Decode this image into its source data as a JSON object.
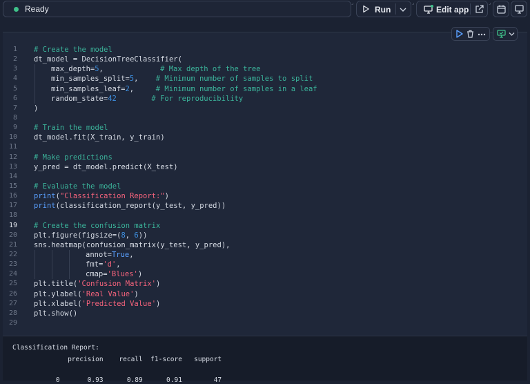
{
  "toolbar": {
    "status": "Ready",
    "run_label": "Run",
    "edit_app_label": "Edit app",
    "colors": {
      "status_dot": "#3fc28a",
      "accent": "#3e8fe0"
    }
  },
  "code": {
    "active_line": 19,
    "lines": [
      {
        "n": "1",
        "segs": [
          {
            "t": "# Create the model",
            "k": "comment"
          }
        ]
      },
      {
        "n": "2",
        "segs": [
          {
            "t": "dt_model = DecisionTreeClassifier(",
            "k": "plain"
          }
        ]
      },
      {
        "n": "3",
        "indent": 1,
        "segs": [
          {
            "t": "max_depth=",
            "k": "plain"
          },
          {
            "t": "5",
            "k": "num"
          },
          {
            "t": ",             ",
            "k": "plain"
          },
          {
            "t": "# Max depth of the tree",
            "k": "comment"
          }
        ]
      },
      {
        "n": "4",
        "indent": 1,
        "segs": [
          {
            "t": "min_samples_split=",
            "k": "plain"
          },
          {
            "t": "5",
            "k": "num"
          },
          {
            "t": ",    ",
            "k": "plain"
          },
          {
            "t": "# Minimum number of samples to split",
            "k": "comment"
          }
        ]
      },
      {
        "n": "5",
        "indent": 1,
        "segs": [
          {
            "t": "min_samples_leaf=",
            "k": "plain"
          },
          {
            "t": "2",
            "k": "num"
          },
          {
            "t": ",     ",
            "k": "plain"
          },
          {
            "t": "# Minimum number of samples in a leaf",
            "k": "comment"
          }
        ]
      },
      {
        "n": "6",
        "indent": 1,
        "segs": [
          {
            "t": "random_state=",
            "k": "plain"
          },
          {
            "t": "42",
            "k": "num"
          },
          {
            "t": "        ",
            "k": "plain"
          },
          {
            "t": "# For reproducibility",
            "k": "comment"
          }
        ]
      },
      {
        "n": "7",
        "segs": [
          {
            "t": ")",
            "k": "plain"
          }
        ]
      },
      {
        "n": "8",
        "segs": []
      },
      {
        "n": "9",
        "segs": [
          {
            "t": "# Train the model",
            "k": "comment"
          }
        ]
      },
      {
        "n": "10",
        "segs": [
          {
            "t": "dt_model.fit(X_train, y_train)",
            "k": "plain"
          }
        ]
      },
      {
        "n": "11",
        "segs": []
      },
      {
        "n": "12",
        "segs": [
          {
            "t": "# Make predictions",
            "k": "comment"
          }
        ]
      },
      {
        "n": "13",
        "segs": [
          {
            "t": "y_pred = dt_model.predict(X_test)",
            "k": "plain"
          }
        ]
      },
      {
        "n": "14",
        "segs": []
      },
      {
        "n": "15",
        "segs": [
          {
            "t": "# Evaluate the model",
            "k": "comment"
          }
        ]
      },
      {
        "n": "16",
        "segs": [
          {
            "t": "print",
            "k": "fn"
          },
          {
            "t": "(",
            "k": "plain"
          },
          {
            "t": "\"Classification Report:\"",
            "k": "str"
          },
          {
            "t": ")",
            "k": "plain"
          }
        ]
      },
      {
        "n": "17",
        "segs": [
          {
            "t": "print",
            "k": "fn"
          },
          {
            "t": "(classification_report(y_test, y_pred))",
            "k": "plain"
          }
        ]
      },
      {
        "n": "18",
        "segs": []
      },
      {
        "n": "19",
        "segs": [
          {
            "t": "# Create the confusion matrix",
            "k": "comment"
          }
        ]
      },
      {
        "n": "20",
        "segs": [
          {
            "t": "plt.figure(figsize=(",
            "k": "plain"
          },
          {
            "t": "8",
            "k": "num"
          },
          {
            "t": ", ",
            "k": "plain"
          },
          {
            "t": "6",
            "k": "num"
          },
          {
            "t": "))",
            "k": "plain"
          }
        ]
      },
      {
        "n": "21",
        "segs": [
          {
            "t": "sns.heatmap(confusion_matrix(y_test, y_pred),",
            "k": "plain"
          }
        ]
      },
      {
        "n": "22",
        "indent": 3,
        "segs": [
          {
            "t": "annot=",
            "k": "plain"
          },
          {
            "t": "True",
            "k": "kw"
          },
          {
            "t": ",",
            "k": "plain"
          }
        ]
      },
      {
        "n": "23",
        "indent": 3,
        "segs": [
          {
            "t": "fmt=",
            "k": "plain"
          },
          {
            "t": "'d'",
            "k": "str"
          },
          {
            "t": ",",
            "k": "plain"
          }
        ]
      },
      {
        "n": "24",
        "indent": 3,
        "segs": [
          {
            "t": "cmap=",
            "k": "plain"
          },
          {
            "t": "'Blues'",
            "k": "str"
          },
          {
            "t": ")",
            "k": "plain"
          }
        ]
      },
      {
        "n": "25",
        "segs": [
          {
            "t": "plt.title(",
            "k": "plain"
          },
          {
            "t": "'Confusion Matrix'",
            "k": "str"
          },
          {
            "t": ")",
            "k": "plain"
          }
        ]
      },
      {
        "n": "26",
        "segs": [
          {
            "t": "plt.ylabel(",
            "k": "plain"
          },
          {
            "t": "'Real Value'",
            "k": "str"
          },
          {
            "t": ")",
            "k": "plain"
          }
        ]
      },
      {
        "n": "27",
        "segs": [
          {
            "t": "plt.xlabel(",
            "k": "plain"
          },
          {
            "t": "'Predicted Value'",
            "k": "str"
          },
          {
            "t": ")",
            "k": "plain"
          }
        ]
      },
      {
        "n": "28",
        "segs": [
          {
            "t": "plt.show()",
            "k": "plain"
          }
        ]
      },
      {
        "n": "29",
        "segs": []
      }
    ]
  },
  "output": {
    "title": "Classification Report:",
    "header": "              precision    recall  f1-score   support",
    "row": "           0       0.93      0.89      0.91        47"
  }
}
